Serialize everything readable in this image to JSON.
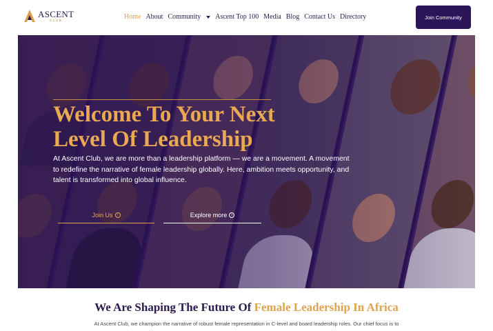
{
  "brand": {
    "name": "ASCENT",
    "sub": "CLUB"
  },
  "nav": {
    "items": [
      {
        "label": "Home",
        "active": true
      },
      {
        "label": "About"
      },
      {
        "label": "Community",
        "dropdown": true
      },
      {
        "label": "Ascent Top 100"
      },
      {
        "label": "Media"
      },
      {
        "label": "Blog"
      },
      {
        "label": "Contact Us"
      },
      {
        "label": "Directory"
      }
    ],
    "cta": "Join Community"
  },
  "hero": {
    "title": "Welcome To Your Next Level Of Leadership",
    "text": "At Ascent Club, we are more than a leadership platform — we are a movement. A movement to redefine the narrative of female leadership globally. Here, ambition meets opportunity, and talent is transformed into global influence.",
    "btn_join": "Join Us",
    "btn_explore": "Explore more"
  },
  "section": {
    "title_main": "We Are Shaping The Future Of ",
    "title_highlight": "Female Leadership In Africa",
    "text": "At Ascent Club, we champion the narrative of robust female representation in C-level and board leadership roles. Our chief focus is to"
  },
  "colors": {
    "primary": "#2a1559",
    "accent": "#e0a24c"
  }
}
